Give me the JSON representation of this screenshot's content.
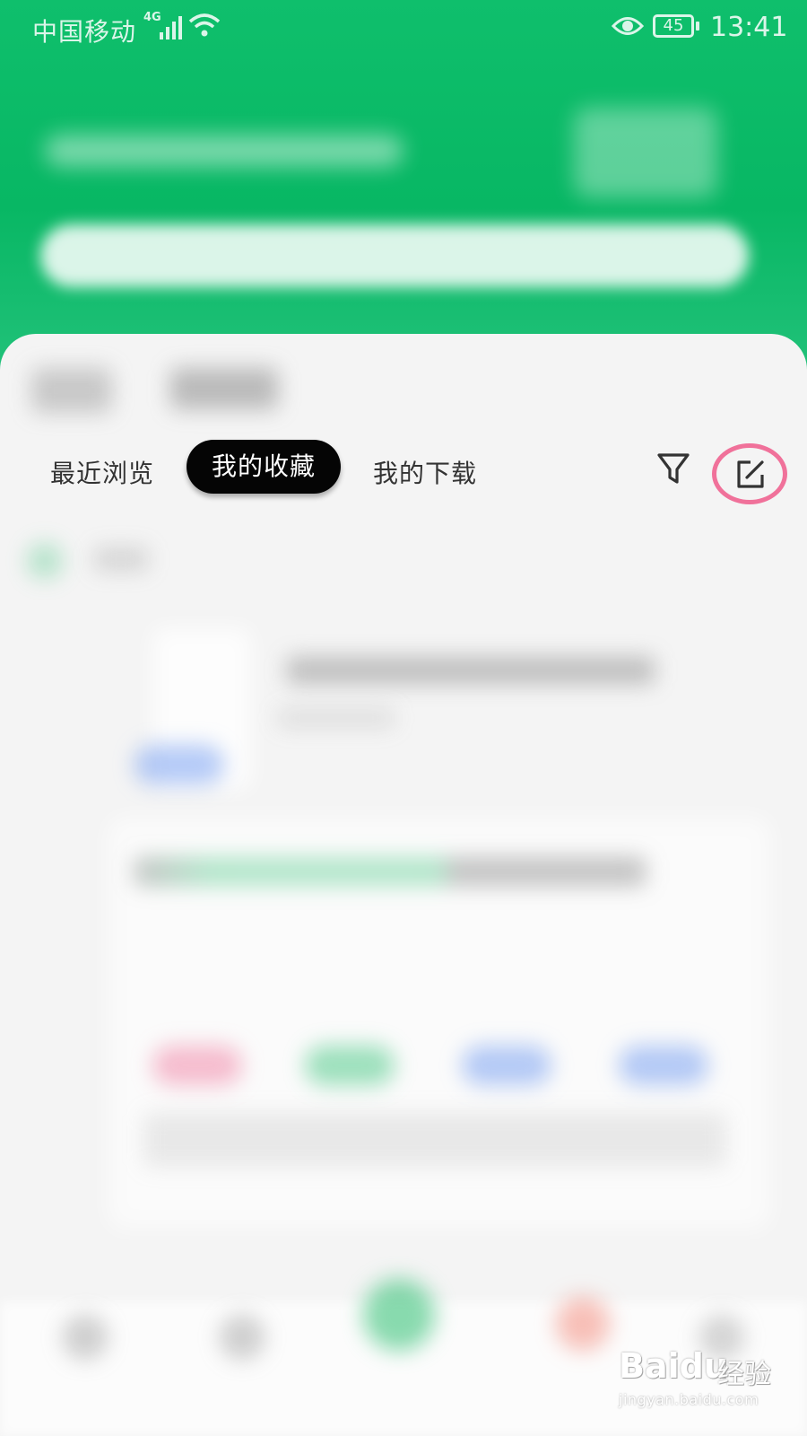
{
  "status_bar": {
    "carrier": "中国移动",
    "network": "4G",
    "battery": "45",
    "time": "13:41"
  },
  "tabs": {
    "recent": "最近浏览",
    "favorites": "我的收藏",
    "downloads": "我的下载",
    "selected": "favorites"
  },
  "icons": {
    "filter": "filter-icon",
    "edit": "edit-icon",
    "highlight_color": "#f0719a"
  },
  "watermark": {
    "logo": "Baidu",
    "text": "经验",
    "url": "jingyan.baidu.com"
  },
  "colors": {
    "header_green": "#08b764",
    "selected_tab_bg": "#050505"
  }
}
